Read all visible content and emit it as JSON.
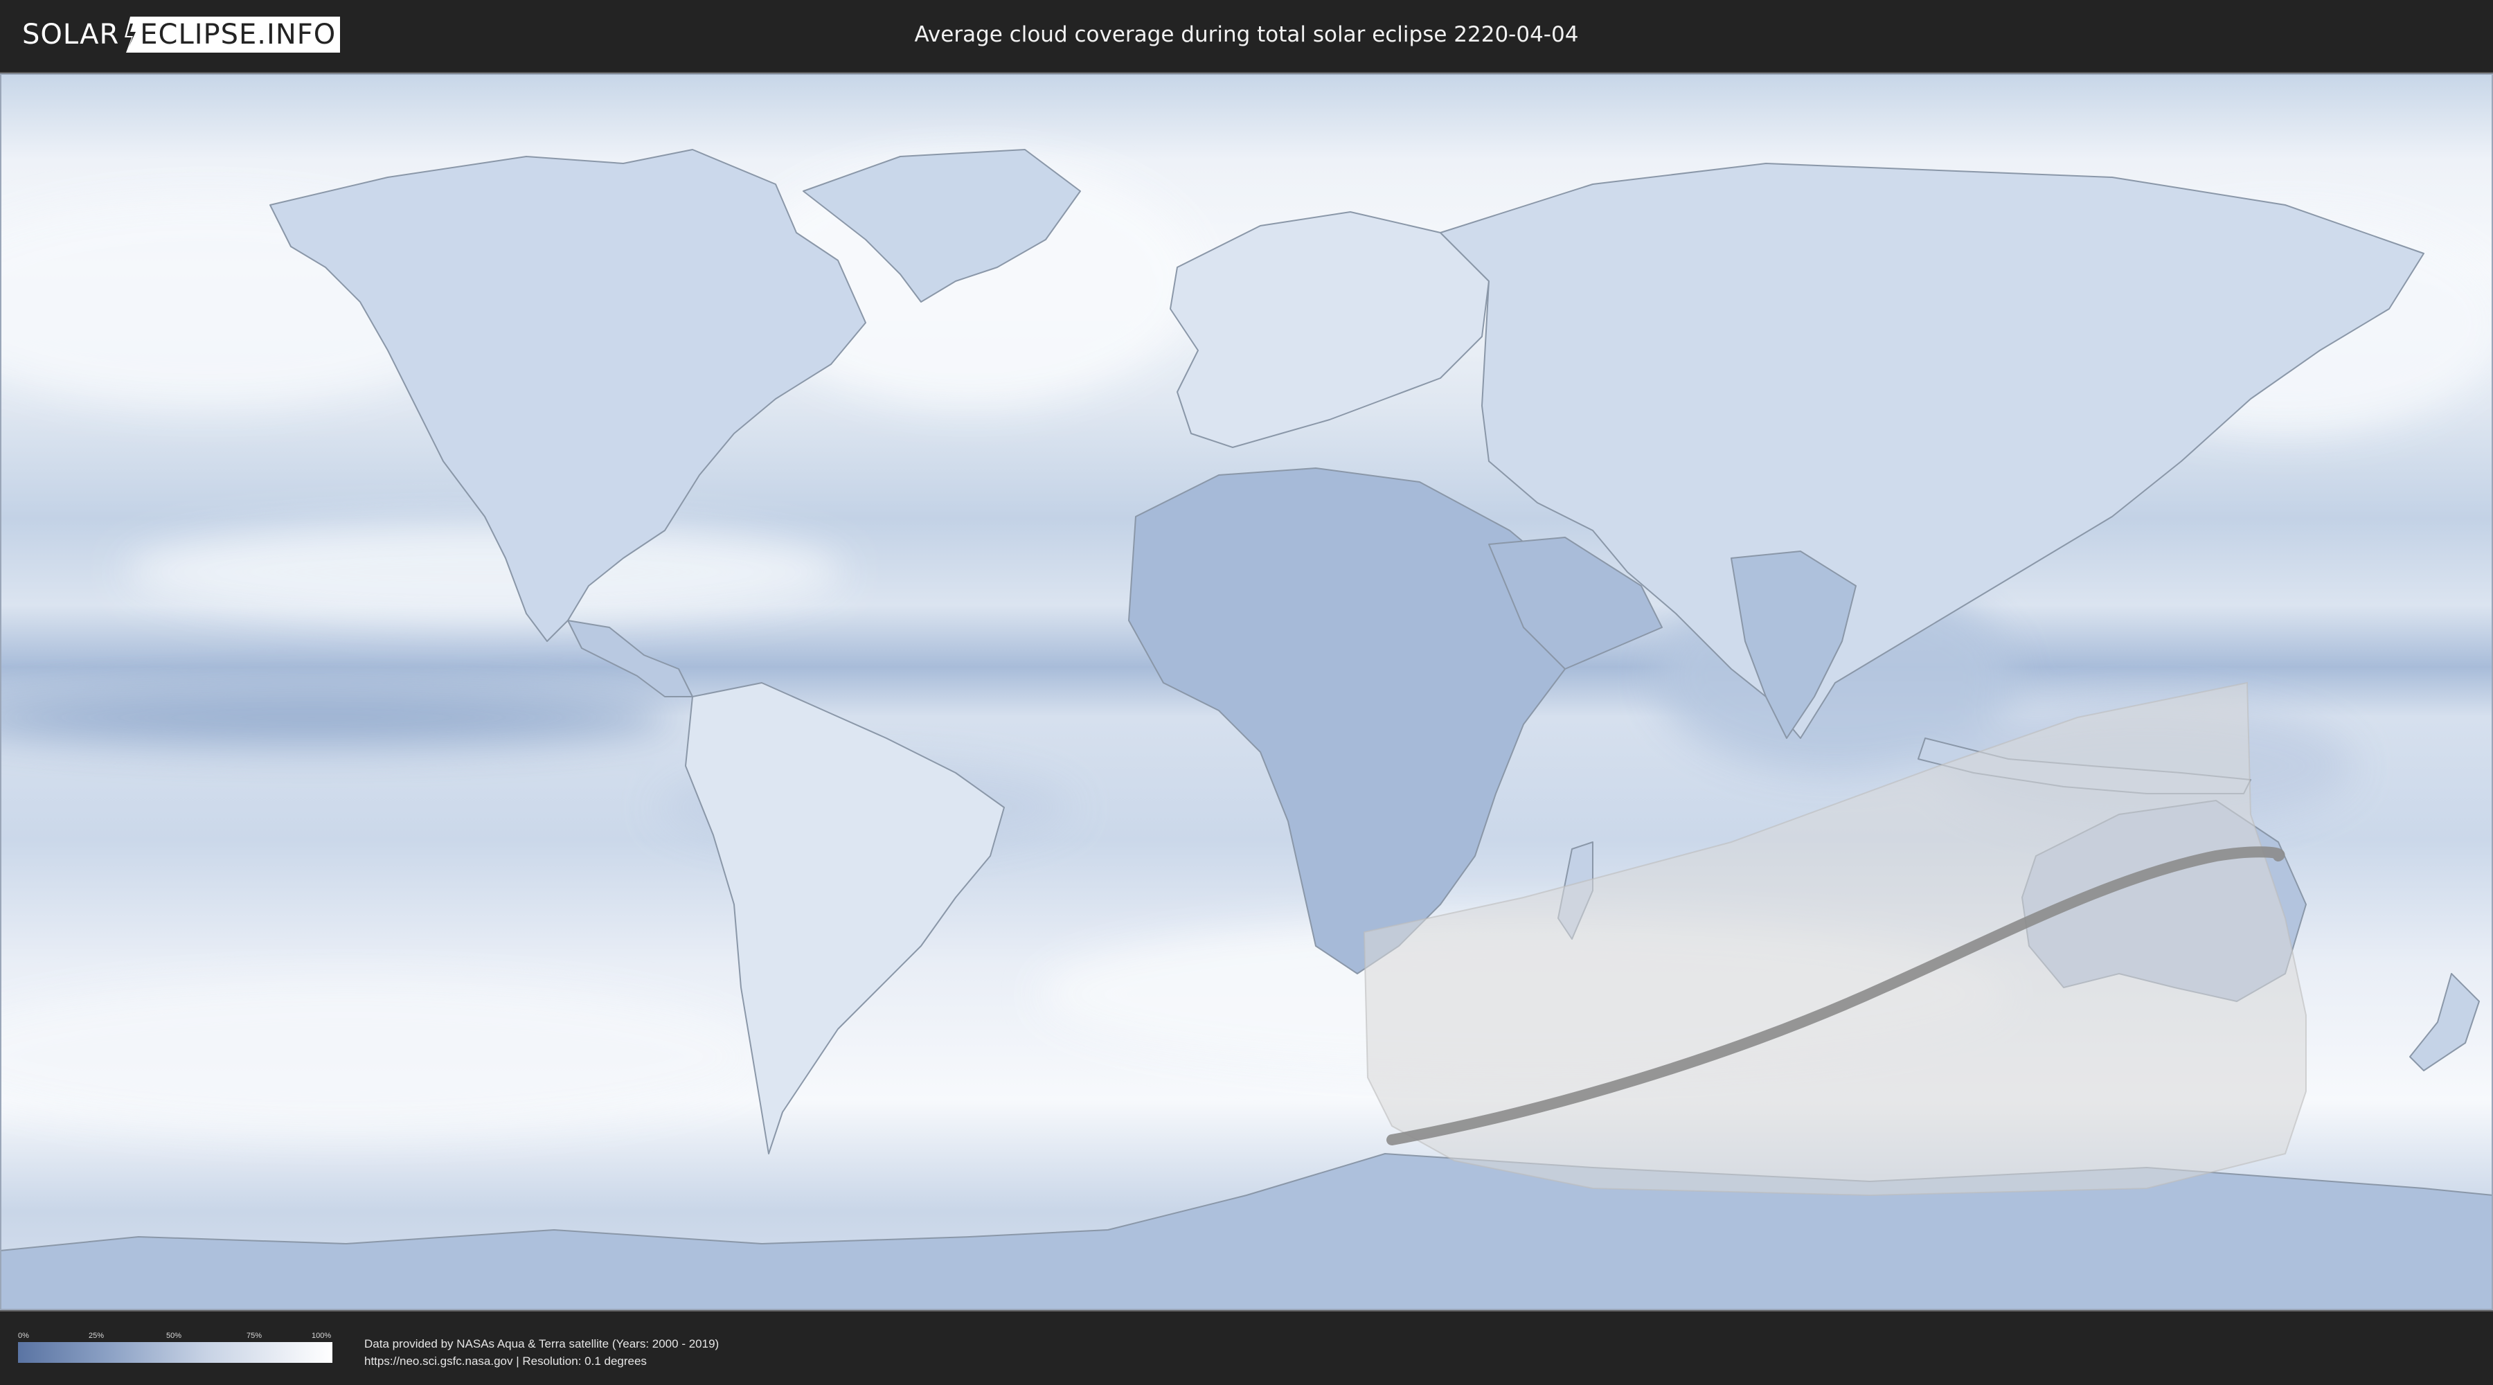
{
  "header": {
    "logo_left": "SOLAR",
    "logo_right": "ECLIPSE.INFO",
    "title": "Average cloud coverage during total solar eclipse 2220-04-04"
  },
  "legend": {
    "ticks": [
      "0%",
      "25%",
      "50%",
      "75%",
      "100%"
    ],
    "low_color": "#5a74a3",
    "high_color": "#ffffff"
  },
  "footer": {
    "credit_line1": "Data provided by NASAs Aqua & Terra satellite (Years: 2000 - 2019)",
    "credit_line2": "https://neo.sci.gsfc.nasa.gov | Resolution: 0.1 degrees"
  },
  "colors": {
    "background": "#232323",
    "cloud_low": "#6a84b3",
    "cloud_high": "#f4f6fa",
    "eclipse_visibility_zone": "#d9d9d9",
    "totality_path": "#8c8c8c"
  },
  "icons": {
    "logo_bolt": "lightning-bolt-icon"
  }
}
